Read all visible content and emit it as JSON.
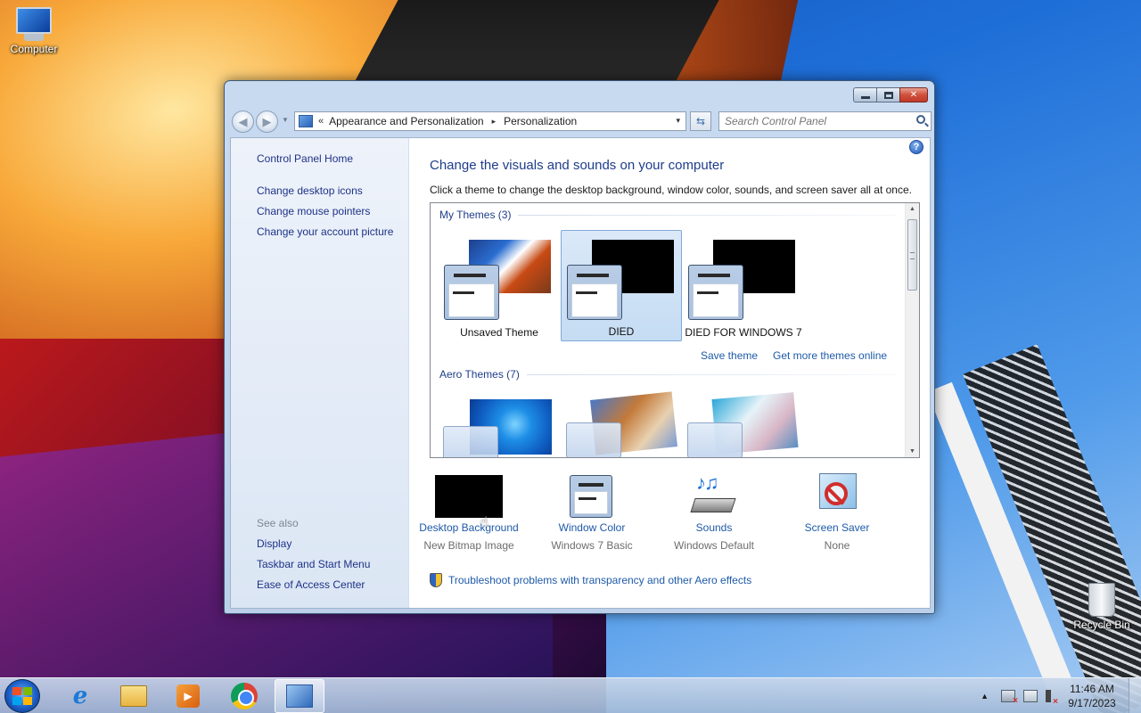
{
  "desktop": {
    "icons": [
      {
        "label": "Computer",
        "icon": "computer-icon"
      },
      {
        "label": "Recycle Bin",
        "icon": "recycle-bin-icon"
      }
    ]
  },
  "window": {
    "caption_buttons": {
      "close": "✕"
    },
    "address_bar": {
      "chevron": "«",
      "crumbs": [
        "Appearance and Personalization",
        "Personalization"
      ],
      "separator": "▸",
      "dropdown": "▾"
    },
    "search": {
      "placeholder": "Search Control Panel"
    },
    "help": "?",
    "left_pane": {
      "home": "Control Panel Home",
      "links": [
        "Change desktop icons",
        "Change mouse pointers",
        "Change your account picture"
      ],
      "see_also_title": "See also",
      "see_also": [
        "Display",
        "Taskbar and Start Menu",
        "Ease of Access Center"
      ]
    },
    "main": {
      "title": "Change the visuals and sounds on your computer",
      "subtitle": "Click a theme to change the desktop background, window color, sounds, and screen saver all at once.",
      "my_themes_header": "My Themes (3)",
      "my_themes": [
        {
          "name": "Unsaved Theme",
          "selected": false
        },
        {
          "name": "DIED",
          "selected": true
        },
        {
          "name": "DIED FOR WINDOWS 7",
          "selected": false
        }
      ],
      "save_theme": "Save theme",
      "more_themes": "Get more themes online",
      "aero_themes_header": "Aero Themes (7)",
      "settings": [
        {
          "label": "Desktop Background",
          "value": "New Bitmap Image",
          "icon": "desktop-background-icon"
        },
        {
          "label": "Window Color",
          "value": "Windows 7 Basic",
          "icon": "window-color-icon"
        },
        {
          "label": "Sounds",
          "value": "Windows Default",
          "icon": "sounds-icon"
        },
        {
          "label": "Screen Saver",
          "value": "None",
          "icon": "screen-saver-icon"
        }
      ],
      "troubleshoot": "Troubleshoot problems with transparency and other Aero effects"
    }
  },
  "taskbar": {
    "apps": [
      {
        "name": "Internet Explorer",
        "icon": "internet-explorer-icon",
        "active": false
      },
      {
        "name": "Windows Explorer",
        "icon": "folder-icon",
        "active": false
      },
      {
        "name": "Windows Media Player",
        "icon": "media-player-icon",
        "active": false
      },
      {
        "name": "Google Chrome",
        "icon": "chrome-icon",
        "active": false
      },
      {
        "name": "Control Panel",
        "icon": "control-panel-icon",
        "active": true
      }
    ],
    "tray": {
      "arrow": "▲",
      "time": "11:46 AM",
      "date": "9/17/2023"
    }
  },
  "colors": {
    "link": "#1e5aa8",
    "title": "#1e3d8a",
    "nav_link": "#1e3287",
    "selection": "#c5dcf3"
  }
}
